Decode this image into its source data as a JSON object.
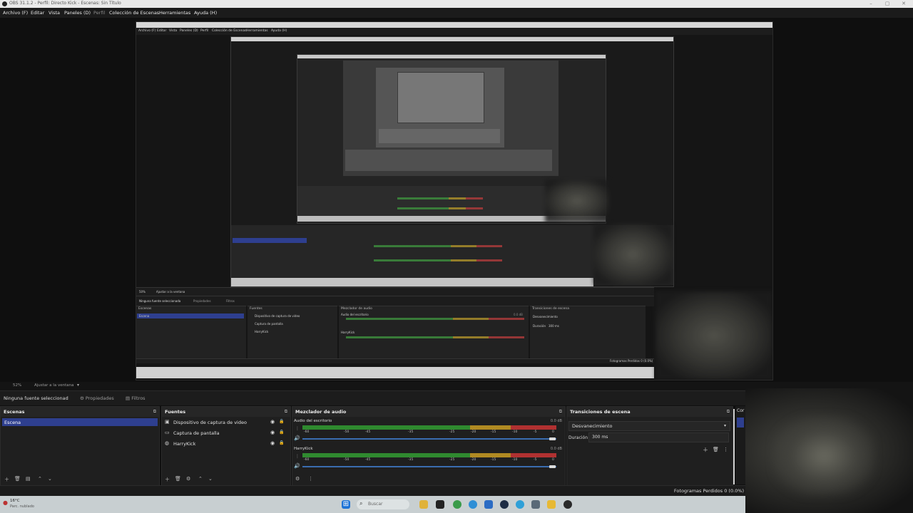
{
  "window": {
    "title": "OBS 31.1.2 - Perfil: Directo Kick - Escenas: Sin Título",
    "controls": [
      "–",
      "▢",
      "✕"
    ]
  },
  "menu": [
    {
      "label": "Archivo (F)",
      "dim": false
    },
    {
      "label": "Editar",
      "dim": false
    },
    {
      "label": "Vista",
      "dim": false
    },
    {
      "label": "Paneles (D)",
      "dim": false
    },
    {
      "label": "Perfil",
      "dim": true
    },
    {
      "label": "Colección de Escenas",
      "dim": false
    },
    {
      "label": "Herramientas",
      "dim": false
    },
    {
      "label": "Ayuda (H)",
      "dim": false
    }
  ],
  "preview_nested": {
    "menu": [
      "Archivo (F)",
      "Editar",
      "Vista",
      "Paneles (D)",
      "Perfil",
      "Colección de Escenas",
      "Herramientas",
      "Ayuda (H)"
    ],
    "context_none": "Ninguna fuente seleccionada",
    "props": "Propiedades",
    "filters": "Filtros",
    "scenes_title": "Escenas",
    "scene_item": "Escena",
    "sources_title": "Fuentes",
    "sources": [
      "Dispositivo de captura de video",
      "Captura de pantalla",
      "HarryKick"
    ],
    "mixer_title": "Mezclador de audio",
    "ch1": "Audio del escritorio",
    "ch2": "HarryKick",
    "db": "0.0 dB",
    "transitions_title": "Transiciones de escena",
    "transition": "Desvanecimiento",
    "duration_label": "Duración",
    "duration": "300 ms",
    "dropped": "Fotogramas Perdidos 0 (0.0%)",
    "zoom": "50%",
    "fit": "Ajustar a la ventana"
  },
  "preview_bar": {
    "zoom": "52%",
    "fit": "Ajustar a la ventana"
  },
  "context": {
    "none_selected": "Ninguna fuente seleccionad",
    "properties": "Propiedades",
    "filters": "Filtros"
  },
  "scenes": {
    "title": "Escenas",
    "items": [
      "Escena"
    ]
  },
  "sources": {
    "title": "Fuentes",
    "items": [
      {
        "label": "Dispositivo de captura de video",
        "icon": "camera-icon"
      },
      {
        "label": "Captura de pantalla",
        "icon": "monitor-icon"
      },
      {
        "label": "HarryKick",
        "icon": "globe-icon"
      }
    ]
  },
  "mixer": {
    "title": "Mezclador de audio",
    "scale": [
      "-60",
      "-55",
      "-50",
      "-45",
      "-40",
      "-35",
      "-30",
      "-25",
      "-20",
      "-15",
      "-10",
      "-5",
      "0"
    ],
    "channels": [
      {
        "name": "Audio del escritorio",
        "db": "0.0 dB",
        "volume": 1.0
      },
      {
        "name": "HarryKick",
        "db": "0.0 dB",
        "volume": 1.0
      }
    ]
  },
  "transitions": {
    "title": "Transiciones de escena",
    "selected": "Desvanecimiento",
    "duration_label": "Duración",
    "duration": "300 ms",
    "controls_hint": "Cor"
  },
  "status": {
    "dropped_frames": "Fotogramas Perdidos 0 (0.0%)"
  },
  "taskbar": {
    "temp": "16°C",
    "weather": "Parc. nublado",
    "search_placeholder": "Buscar",
    "icons": [
      {
        "name": "windows-start-icon",
        "color": "#1e73d6"
      },
      {
        "name": "file-explorer-icon",
        "color": "#e0b23a"
      },
      {
        "name": "terminal-icon",
        "color": "#222222"
      },
      {
        "name": "chrome-icon",
        "color": "#3a9b4a"
      },
      {
        "name": "edge-icon",
        "color": "#2f8fd6"
      },
      {
        "name": "photos-icon",
        "color": "#2b6cc4"
      },
      {
        "name": "steam-icon",
        "color": "#1d2c44"
      },
      {
        "name": "store-icon",
        "color": "#2fa0d8"
      },
      {
        "name": "settings-icon",
        "color": "#5a6a78"
      },
      {
        "name": "folder-icon",
        "color": "#e7b935"
      },
      {
        "name": "obs-icon",
        "color": "#2a2a2a"
      }
    ]
  },
  "colors": {
    "accent": "#2e3f8f",
    "meter_green": "#2f8a2f",
    "meter_yellow": "#b08a22",
    "meter_red": "#b13131"
  }
}
